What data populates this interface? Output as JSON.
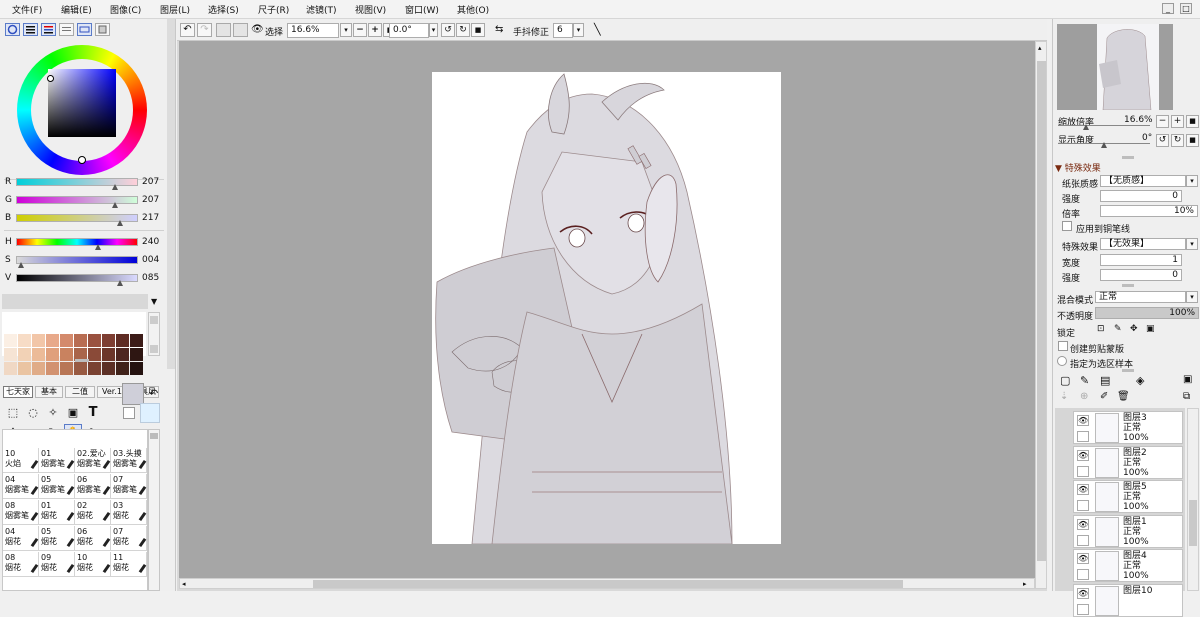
{
  "menu": [
    "文件(F)",
    "编辑(E)",
    "图像(C)",
    "图层(L)",
    "选择(S)",
    "尺子(R)",
    "滤镜(T)",
    "视图(V)",
    "窗口(W)",
    "其他(O)"
  ],
  "window_buttons": [
    "_",
    "□"
  ],
  "color": {
    "r_label": "R",
    "g_label": "G",
    "b_label": "B",
    "h_label": "H",
    "s_label": "S",
    "v_label": "V",
    "r": "207",
    "g": "207",
    "b": "217",
    "h": "240",
    "s": "004",
    "v": "085",
    "r_frac": 0.81,
    "g_frac": 0.81,
    "b_frac": 0.85,
    "h_frac": 0.66,
    "s_frac": 0.04,
    "v_frac": 0.85,
    "current_hex": "#cfcfd9"
  },
  "palette_top": [
    "#5a1010",
    "#ffffff",
    "#111111",
    "#6e6e6e",
    "#9e9e9e",
    "#b8b8b8",
    "#e02040",
    "#e8143c",
    "#808080",
    "#9a9a9a"
  ],
  "palette_grid": [
    [
      "#fbefe4",
      "#f7dcc6",
      "#f2c6a8",
      "#e8a98a",
      "#d48a6c",
      "#b86d52",
      "#9a5240",
      "#7e3e32",
      "#5f2c24",
      "#3c1c18"
    ],
    [
      "#f6e4d4",
      "#f2d2b6",
      "#ecbb98",
      "#e0a07c",
      "#c9825f",
      "#a9654a",
      "#8a4a38",
      "#6c362a",
      "#4e2620",
      "#2e1612"
    ],
    [
      "#f0d8c4",
      "#eac4a2",
      "#e0ac88",
      "#d29270",
      "#b87656",
      "#985a42",
      "#7a4232",
      "#5c3026",
      "#40221a",
      "#241210"
    ]
  ],
  "tool_tabs": [
    "七天家",
    "基本",
    "二值",
    "Ver.1",
    "画具风"
  ],
  "toolbar": {
    "select_label": "选择",
    "zoom": "16.6%",
    "angle": "0.0°",
    "stab_label": "手抖修正",
    "stab": "6"
  },
  "brushes": [
    [
      [
        "10",
        "火焰"
      ],
      [
        "01",
        "烟雾笔"
      ],
      [
        "02.爱心",
        "烟雾笔"
      ],
      [
        "03.头摸",
        "烟雾笔"
      ]
    ],
    [
      [
        "04",
        "烟雾笔"
      ],
      [
        "05",
        "烟雾笔"
      ],
      [
        "06",
        "烟雾笔"
      ],
      [
        "07",
        "烟雾笔"
      ]
    ],
    [
      [
        "08",
        "烟雾笔"
      ],
      [
        "01",
        "烟花"
      ],
      [
        "02",
        "烟花"
      ],
      [
        "03",
        "烟花"
      ]
    ],
    [
      [
        "04",
        "烟花"
      ],
      [
        "05",
        "烟花"
      ],
      [
        "06",
        "烟花"
      ],
      [
        "07",
        "烟花"
      ]
    ],
    [
      [
        "08",
        "烟花"
      ],
      [
        "09",
        "烟花"
      ],
      [
        "10",
        "烟花"
      ],
      [
        "11",
        "烟花"
      ]
    ]
  ],
  "navigator": {
    "zoom_label": "缩放倍率",
    "zoom": "16.6%",
    "angle_label": "显示角度",
    "angle": "0°"
  },
  "effects": {
    "section": "特殊效果",
    "paper_label": "纸张质感",
    "paper_value": "【无质感】",
    "strength_label": "强度",
    "strength_value": "0",
    "scale_label": "倍率",
    "scale_value": "10%",
    "apply_pen": "应用到铜笔线",
    "effect_label": "特殊效果",
    "effect_value": "【无效果】",
    "width_label": "宽度",
    "width_value": "1",
    "strength2_label": "强度",
    "strength2_value": "0"
  },
  "layer_props": {
    "blend_label": "混合模式",
    "blend_value": "正常",
    "opacity_label": "不透明度",
    "opacity_value": "100%",
    "lock_label": "锁定",
    "clip_label": "创建剪贴蒙版",
    "sample_label": "指定为选区样本"
  },
  "layers": [
    {
      "name": "图层3",
      "mode": "正常",
      "opacity": "100%"
    },
    {
      "name": "图层2",
      "mode": "正常",
      "opacity": "100%"
    },
    {
      "name": "图层5",
      "mode": "正常",
      "opacity": "100%"
    },
    {
      "name": "图层1",
      "mode": "正常",
      "opacity": "100%"
    },
    {
      "name": "图层4",
      "mode": "正常",
      "opacity": "100%"
    },
    {
      "name": "图层10",
      "mode": "",
      "opacity": ""
    }
  ]
}
